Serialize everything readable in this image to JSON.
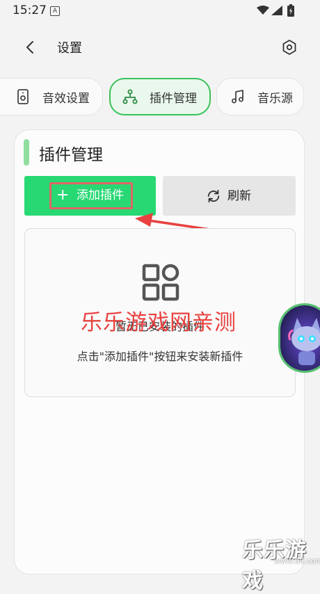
{
  "status_bar": {
    "time": "15:27",
    "notification_badge": "A"
  },
  "header": {
    "title": "设置"
  },
  "tabs": [
    {
      "label": "音效设置",
      "icon": "speaker-icon",
      "active": false
    },
    {
      "label": "插件管理",
      "icon": "plugin-tree-icon",
      "active": true
    },
    {
      "label": "音乐源",
      "icon": "music-note-icon",
      "active": false
    }
  ],
  "plugin_panel": {
    "title": "插件管理",
    "add_label": "添加插件",
    "refresh_label": "刷新",
    "empty_title": "暂无已安装的插件",
    "empty_hint": "点击\"添加插件\"按钮来安装新插件"
  },
  "watermark": {
    "center_text": "乐乐游戏网亲测",
    "corner_text": "乐乐游戏",
    "corner_url": "www.6ll.com"
  },
  "colors": {
    "accent_green": "#27d873",
    "active_tab_border": "#39c35b",
    "watermark_red": "#e8413f"
  }
}
